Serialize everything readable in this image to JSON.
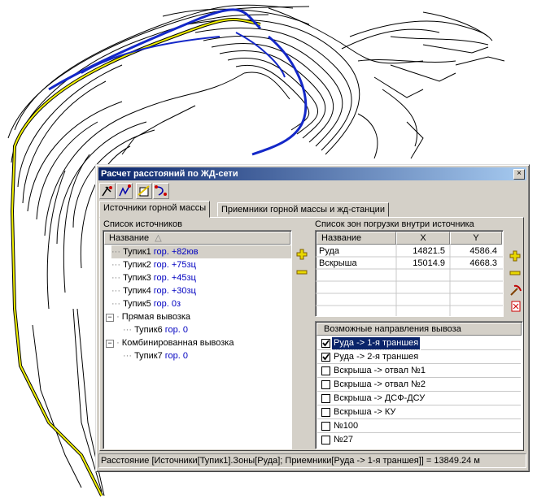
{
  "window": {
    "title": "Расчет расстояний по ЖД-сети",
    "close": "×"
  },
  "toolbar": {
    "icons": [
      "pick-tool-icon",
      "track-tool-icon",
      "zone-tool-icon",
      "route-tool-icon"
    ]
  },
  "tabs": [
    {
      "label": "Источники горной массы",
      "active": true
    },
    {
      "label": "Приемники горной массы и жд-станции",
      "active": false
    }
  ],
  "sources": {
    "title": "Список источников",
    "column": "Название",
    "sort": "△",
    "items": [
      {
        "name": "Тупик1",
        "level": "гор. +82юв",
        "selected": true
      },
      {
        "name": "Тупик2",
        "level": "гор. +75зц"
      },
      {
        "name": "Тупик3",
        "level": "гор. +45зц"
      },
      {
        "name": "Тупик4",
        "level": "гор. +30зц"
      },
      {
        "name": "Тупик5",
        "level": "гор. 0з"
      },
      {
        "group": "Прямая вывозка",
        "expander": "−"
      },
      {
        "name": "Тупик6",
        "level": "гор. 0"
      },
      {
        "group": "Комбинированная вывозка",
        "expander": "−"
      },
      {
        "name": "Тупик7",
        "level": "гор. 0"
      }
    ]
  },
  "zones": {
    "title": "Список зон погрузки внутри источника",
    "columns": [
      "Название",
      "X",
      "Y"
    ],
    "rows": [
      {
        "name": "Руда",
        "x": "14821.5",
        "y": "4586.4"
      },
      {
        "name": "Вскрыша",
        "x": "15014.9",
        "y": "4668.3"
      }
    ]
  },
  "directions": {
    "title": "Возможные направления вывоза",
    "items": [
      {
        "label": "Руда -> 1-я траншея",
        "checked": true,
        "selected": true
      },
      {
        "label": "Руда -> 2-я траншея",
        "checked": true
      },
      {
        "label": "Вскрыша -> отвал №1",
        "checked": false
      },
      {
        "label": "Вскрыша -> отвал №2",
        "checked": false
      },
      {
        "label": "Вскрыша -> ДСФ-ДСУ",
        "checked": false
      },
      {
        "label": "Вскрыша -> КУ",
        "checked": false
      },
      {
        "label": "№100",
        "checked": false
      },
      {
        "label": "№27",
        "checked": false
      }
    ]
  },
  "side_buttons": {
    "add": "+",
    "remove": "−"
  },
  "status": "Расстояние [Источники[Тупик1].Зоны[Руда]; Приемники[Руда -> 1-я траншея]] = 13849.24 м",
  "colors": {
    "title_start": "#0a246a",
    "title_end": "#a6caf0",
    "track_yellow": "#f0f000",
    "track_blue": "#1428c8",
    "link_blue": "#0000c0",
    "plus_yellow": "#e8d800"
  }
}
